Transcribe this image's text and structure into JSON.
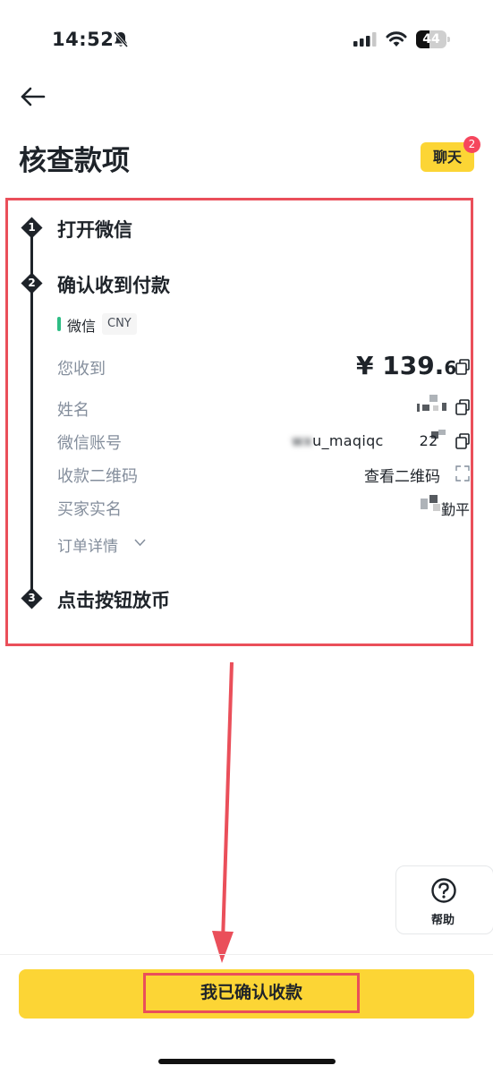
{
  "status_bar": {
    "time": "14:52",
    "battery_level": "44",
    "battery_fraction": 0.44
  },
  "header": {
    "title": "核查款项",
    "chat_label": "聊天",
    "chat_badge": "2"
  },
  "steps": [
    {
      "number": "1",
      "title": "打开微信"
    },
    {
      "number": "2",
      "title": "确认收到付款"
    },
    {
      "number": "3",
      "title": "点击按钮放币"
    }
  ],
  "payment": {
    "method": "微信",
    "currency": "CNY",
    "method_color": "#2ebd85",
    "rows": {
      "received_label": "您收到",
      "amount_main": "¥ 139.",
      "amount_fraction": "6",
      "name_label": "姓名",
      "account_label": "微信账号",
      "account_visible_start": "wx",
      "account_visible_mid": "u_maqiqc",
      "account_visible_end": "22",
      "qr_label": "收款二维码",
      "qr_link": "查看二维码",
      "buyer_label": "买家实名",
      "buyer_visible": "勤平",
      "order_details": "订单详情"
    }
  },
  "help": {
    "label": "帮助"
  },
  "footer": {
    "confirm_label": "我已确认收款"
  },
  "colors": {
    "accent_yellow": "#fcd535",
    "annotation_red": "#ea4f5a",
    "text_primary": "#1e2329",
    "text_secondary": "#848e9c"
  }
}
